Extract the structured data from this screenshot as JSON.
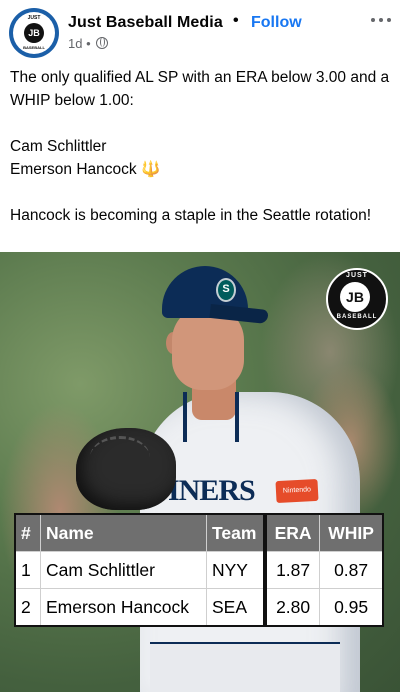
{
  "post": {
    "page_name": "Just Baseball Media",
    "separator": "•",
    "follow_label": "Follow",
    "time": "1d",
    "meta_dot": "•",
    "avatar_text": "JB",
    "avatar_top": "JUST",
    "avatar_bottom": "BASEBALL",
    "text_lines": [
      "The only qualified AL SP with an ERA below 3.00 and a WHIP below 1.00:",
      "",
      "Cam Schlittler",
      "Emerson Hancock",
      "",
      "Hancock is becoming a staple in the Seattle rotation!"
    ],
    "emoji": "🔱"
  },
  "image": {
    "watermark_top": "JUST",
    "watermark_center": "JB",
    "watermark_bottom": "BASEBALL",
    "jersey_text": "INERS",
    "cap_logo": "S",
    "patch_text": "Nintendo",
    "table": {
      "headers": [
        "#",
        "Name",
        "Team",
        "ERA",
        "WHIP"
      ],
      "rows": [
        [
          "1",
          "Cam Schlittler",
          "NYY",
          "1.87",
          "0.87"
        ],
        [
          "2",
          "Emerson Hancock",
          "SEA",
          "2.80",
          "0.95"
        ]
      ]
    }
  },
  "colors": {
    "accent": "#1877f2",
    "secondary_text": "#65676b",
    "table_header": "#6f6f6f",
    "mariners_navy": "#0c2c56"
  },
  "icons": {
    "more": "more-dots-icon",
    "audience": "globe-icon",
    "emoji": "trident-emoji"
  }
}
